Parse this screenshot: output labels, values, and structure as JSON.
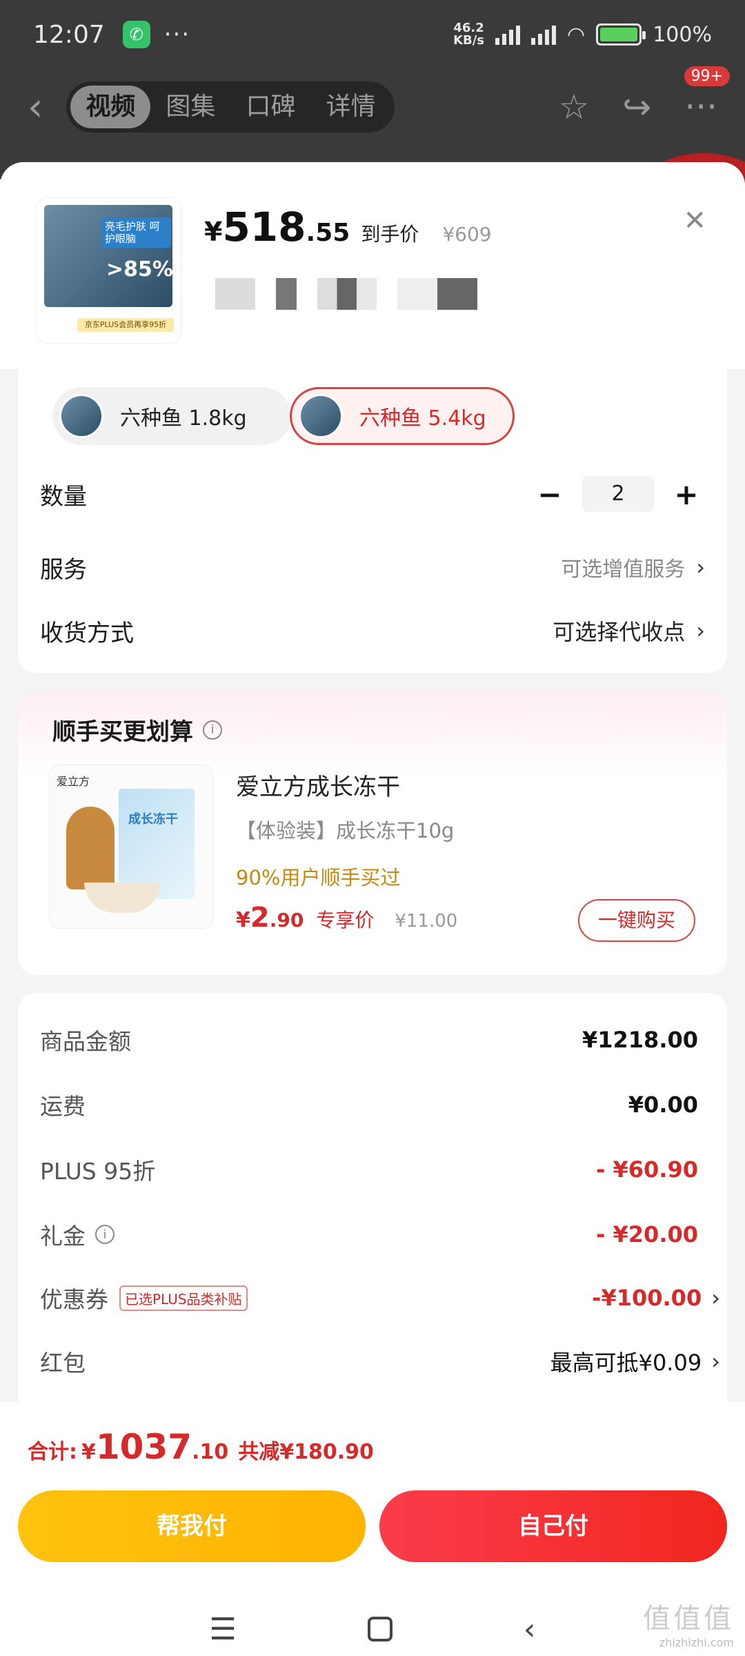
{
  "status_bar": {
    "time": "12:07",
    "dots": "···",
    "net_speed_value": "46.2",
    "net_speed_unit": "KB/s",
    "battery": "100%",
    "battery_level": 1.0
  },
  "background_nav": {
    "tabs": [
      {
        "label": "视频",
        "active": true
      },
      {
        "label": "图集",
        "active": false
      },
      {
        "label": "口碑",
        "active": false
      },
      {
        "label": "详情",
        "active": false
      }
    ],
    "more_badge": "99+"
  },
  "product": {
    "pkg_label": "亮毛护肤 呵护眼脑",
    "pkg_highlight": ">85%",
    "pkg_strip": "京东PLUS会员再享95折",
    "price_yen": "¥",
    "price_int": "518",
    "price_dec": ".55",
    "price_tag": "到手价",
    "price_original": "¥609"
  },
  "specs": {
    "options": [
      {
        "label": "六种鱼 1.8kg",
        "selected": false
      },
      {
        "label": "六种鱼 5.4kg",
        "selected": true
      }
    ],
    "quantity_label": "数量",
    "quantity_value": "2",
    "minus": "−",
    "plus": "+",
    "service_label": "服务",
    "service_value": "可选增值服务",
    "delivery_label": "收货方式",
    "delivery_value": "可选择代收点",
    "chevron": "›"
  },
  "addon": {
    "title": "顺手买更划算",
    "brand": "爱立方",
    "bag_text": "成长冻干",
    "name": "爱立方成长冻干",
    "spec": "【体验装】成长冻干10g",
    "hint": "90%用户顺手买过",
    "price_yen": "¥",
    "price_int": "2",
    "price_dec": ".90",
    "price_tag": "专享价",
    "price_original": "¥11.00",
    "buy_label": "一键购买"
  },
  "summary": {
    "rows": [
      {
        "label": "商品金额",
        "value": "¥1218.00"
      },
      {
        "label": "运费",
        "value": "¥0.00"
      },
      {
        "label": "PLUS 95折",
        "value": "- ¥60.90"
      },
      {
        "label": "礼金",
        "value": "- ¥20.00"
      },
      {
        "label": "优惠券",
        "tag": "已选PLUS品类补贴",
        "value": "-¥100.00"
      },
      {
        "label": "红包",
        "value": "最高可抵¥0.09"
      }
    ]
  },
  "footer": {
    "total_label": "合计:",
    "total_yen": "¥",
    "total_int": "1037",
    "total_dec": ".10",
    "total_saving": "共减¥180.90",
    "pay_help": "帮我付",
    "pay_self": "自己付"
  },
  "watermark": {
    "big": "值值值",
    "small": "zhizhizhi.com"
  },
  "colors": {
    "accent_red": "#d42a2a",
    "pay_help": "#ffbf0e",
    "pay_self": "#f5302a",
    "addon_hint": "#c48a10"
  }
}
